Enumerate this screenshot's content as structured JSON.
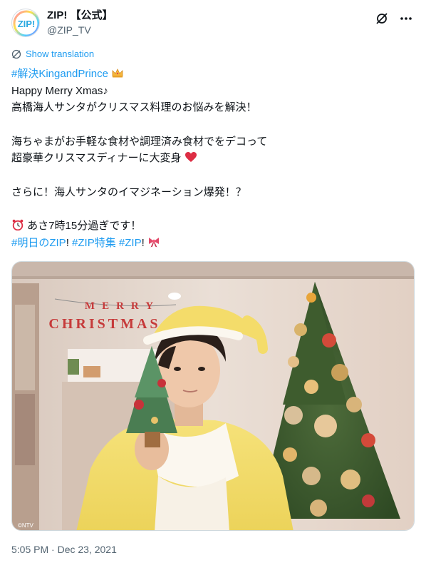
{
  "account": {
    "display_name": "ZIP! 【公式】",
    "handle": "@ZIP_TV",
    "avatar_text": "ZIP!"
  },
  "header_icons": [
    "grok-icon",
    "more-icon"
  ],
  "translate_label": "Show translation",
  "tweet": {
    "hashtag_top": "#解決KingandPrince",
    "line1": "Happy Merry Xmas♪",
    "line2": "高橋海人サンタがクリスマス料理のお悩みを解決！",
    "line3": "海ちゃまがお手軽な食材や調理済み食材でをデコって",
    "line4": "超豪華クリスマスディナーに大変身",
    "line5": "さらに！海人サンタのイマジネーション爆発！？",
    "line6": "あさ7時15分過ぎです！",
    "hashtag1": "#明日のZIP",
    "hashtag2": "#ZIP特集",
    "hashtag3": "#ZIP",
    "sep1": "! ",
    "sep2": " ",
    "sep3": "!"
  },
  "media": {
    "sign_line1": "MERRY",
    "sign_line2": "CHRISTMAS",
    "credit": "©NTV"
  },
  "timestamp": "5:05 PM · Dec 23, 2021",
  "colors": {
    "link": "#1d9bf0",
    "secondary": "#536471",
    "text": "#0f1419"
  }
}
